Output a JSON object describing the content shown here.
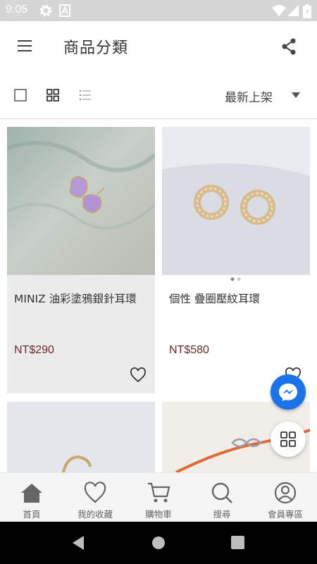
{
  "status_bar": {
    "time": "9:05"
  },
  "header": {
    "title": "商品分類"
  },
  "toolbar": {
    "sort_label": "最新上架"
  },
  "products": [
    {
      "name": "MINIZ 油彩塗鴉銀針耳環",
      "price": "NT$290"
    },
    {
      "name": "個性 疊圈壓紋耳環",
      "price": "NT$580"
    }
  ],
  "bottom_nav": [
    {
      "label": "首頁",
      "icon": "home-icon"
    },
    {
      "label": "我的收藏",
      "icon": "heart-icon"
    },
    {
      "label": "購物車",
      "icon": "cart-icon"
    },
    {
      "label": "搜尋",
      "icon": "search-icon"
    },
    {
      "label": "會員專區",
      "icon": "user-icon"
    }
  ],
  "colors": {
    "price": "#6b2a2a",
    "messenger": "#1a73e8",
    "status_bar": "#d6d6d6"
  }
}
